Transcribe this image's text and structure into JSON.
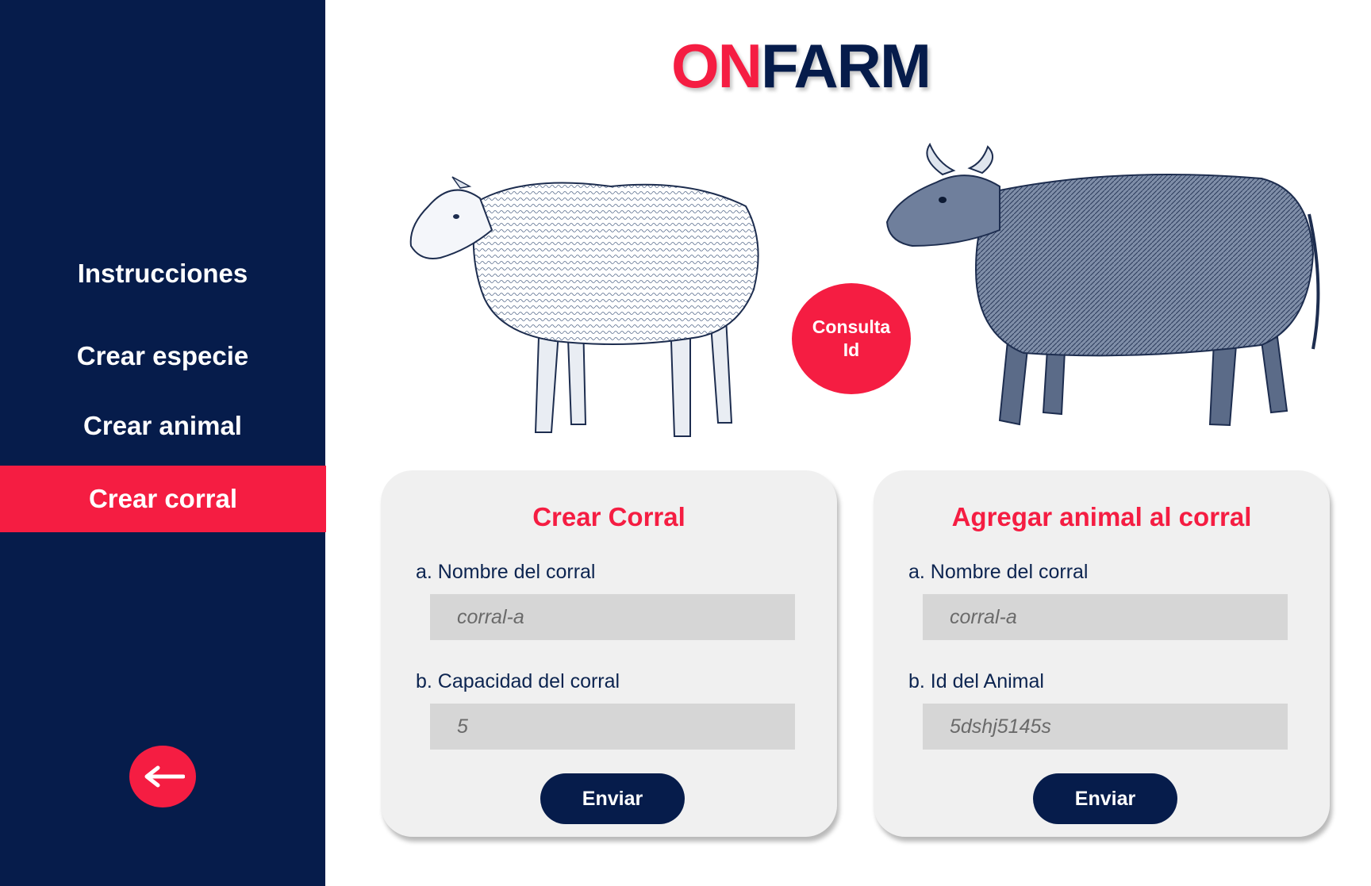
{
  "brand": {
    "logo_on": "ON",
    "logo_farm": "FARM"
  },
  "colors": {
    "navy": "#061c4b",
    "accent_red": "#f51d42",
    "card_bg": "#f0f0f0",
    "input_bg": "#d6d6d6"
  },
  "sidebar": {
    "items": [
      {
        "label": "Instrucciones",
        "active": false
      },
      {
        "label": "Crear especie",
        "active": false
      },
      {
        "label": "Crear animal",
        "active": false
      },
      {
        "label": "Crear corral",
        "active": true
      }
    ],
    "back_icon": "arrow-left-icon"
  },
  "illustrations": {
    "left": "sheep-illustration",
    "right": "bull-illustration"
  },
  "consulta_button": {
    "line1": "Consulta",
    "line2": "Id"
  },
  "cards": {
    "crear_corral": {
      "title": "Crear Corral",
      "field_a_label": "a. Nombre del corral",
      "field_a_placeholder": "corral-a",
      "field_b_label": "b. Capacidad  del corral",
      "field_b_placeholder": "5",
      "submit_label": "Enviar"
    },
    "agregar_animal": {
      "title": "Agregar animal al corral",
      "field_a_label": "a. Nombre del corral",
      "field_a_placeholder": "corral-a",
      "field_b_label": "b. Id del Animal",
      "field_b_placeholder": "5dshj5145s",
      "submit_label": "Enviar"
    }
  }
}
